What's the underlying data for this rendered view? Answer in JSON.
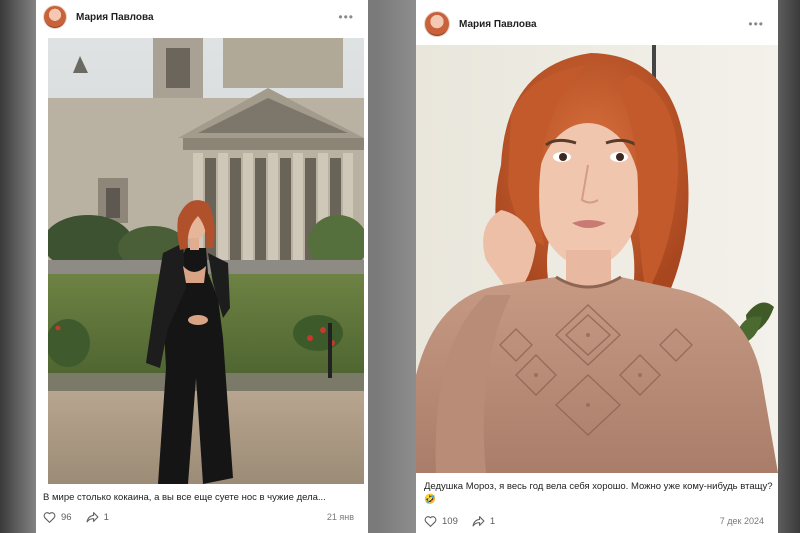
{
  "posts": [
    {
      "author": "Мария Павлова",
      "caption": "В мире столько кокаина, а вы все еще суете нос в чужие дела...",
      "likes": "96",
      "shares": "1",
      "date": "21 янв"
    },
    {
      "author": "Мария Павлова",
      "caption": "Дедушка Мороз, я весь год вела себя хорошо. Можно уже кому-нибудь втащу? 🤣",
      "likes": "109",
      "shares": "1",
      "date": "7 дек 2024"
    }
  ],
  "icons": {
    "more": "more-dots-icon",
    "like": "heart-icon",
    "share": "share-arrow-icon"
  },
  "colors": {
    "card_bg": "#ffffff",
    "text": "#1f1f1f",
    "muted": "#7a7a7a"
  }
}
